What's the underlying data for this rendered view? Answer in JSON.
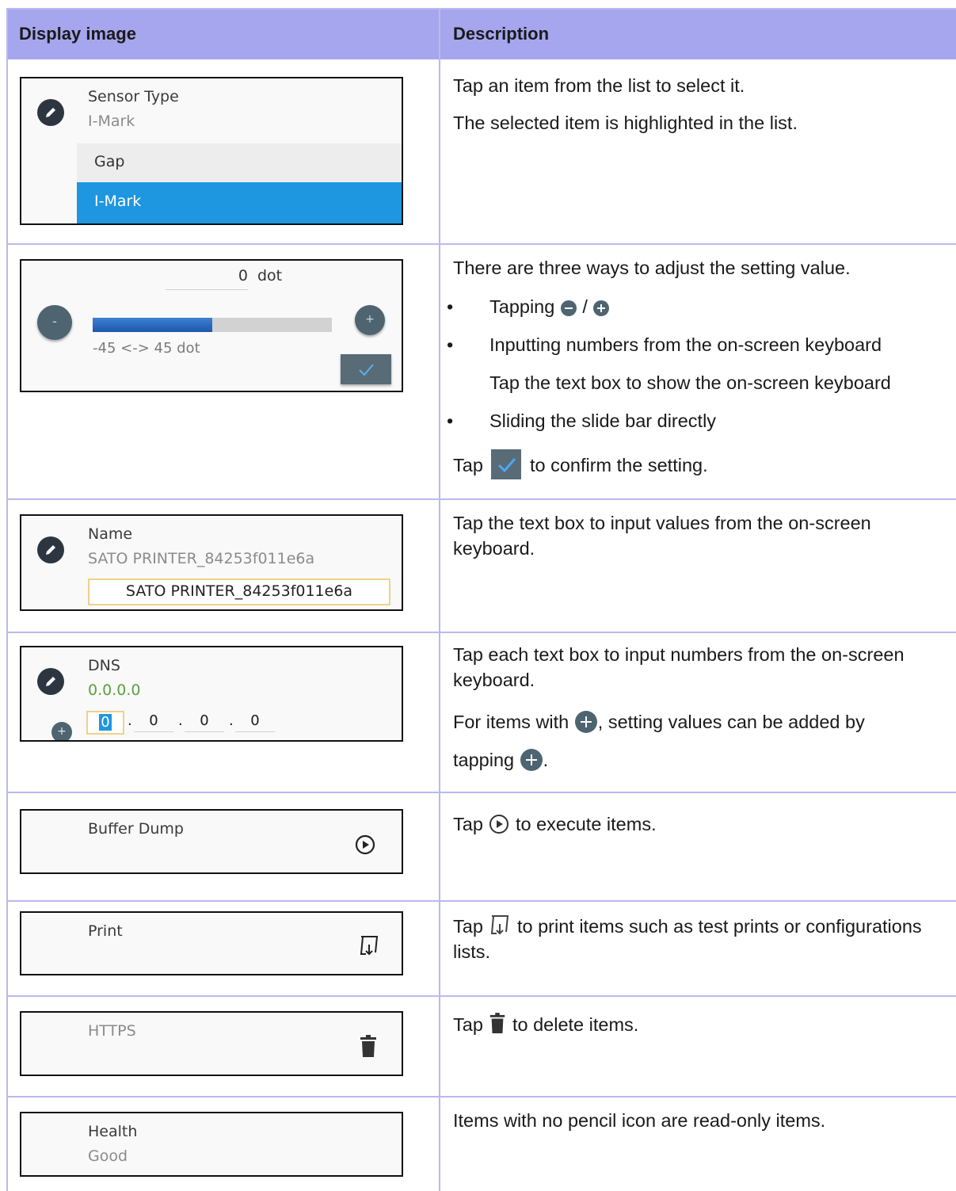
{
  "header": {
    "col1": "Display image",
    "col2": "Description"
  },
  "rows": {
    "list": {
      "title": "Sensor Type",
      "value": "I-Mark",
      "opt1": "Gap",
      "opt2": "I-Mark",
      "desc1": "Tap an item from the list to select it.",
      "desc2": "The selected item is highlighted in the list."
    },
    "slider": {
      "value": "0",
      "unit": "dot",
      "range": "-45 <-> 45 dot",
      "minus": "-",
      "plus": "+",
      "level": 0.5,
      "desc_intro": "There are three ways to adjust the setting value.",
      "bullet1": "Tapping",
      "bullet1_sep": "/",
      "bullet2": "Inputting numbers from the on-screen keyboard",
      "bullet2_sub": "Tap the text box to show the on-screen keyboard",
      "bullet3": "Sliding the slide bar directly",
      "confirm_pre": "Tap",
      "confirm_post": "to confirm the setting."
    },
    "text": {
      "title": "Name",
      "value": "SATO PRINTER_84253f011e6a",
      "input": "SATO PRINTER_84253f011e6a",
      "desc": "Tap the text box to input values from the on-screen keyboard."
    },
    "ip": {
      "title": "DNS",
      "value": "0.0.0.0",
      "oct1": "0",
      "oct2": "0",
      "oct3": "0",
      "oct4": "0",
      "desc1": "Tap each text box to input numbers from the on-screen keyboard.",
      "desc2_pre": "For items with",
      "desc2_post": ", setting values can be added by",
      "desc3_pre": "tapping",
      "desc3_post": "."
    },
    "exec": {
      "title": "Buffer Dump",
      "desc_pre": "Tap",
      "desc_post": "to execute items."
    },
    "print": {
      "title": "Print",
      "desc_pre": "Tap",
      "desc_post": "to print items such as test prints or configurations lists."
    },
    "delete": {
      "title": "HTTPS",
      "desc_pre": "Tap",
      "desc_post": "to delete items."
    },
    "readonly": {
      "title": "Health",
      "value": "Good",
      "desc": "Items with no pencil icon are read-only items."
    }
  },
  "colors": {
    "header_bg": "#a6a6ee",
    "grid": "#b9b9ef",
    "highlight": "#1e96e0",
    "ip_green": "#5aa040",
    "slider_fill": "#2f6bbf"
  },
  "icons": [
    "pencil-icon",
    "minus-icon",
    "plus-icon",
    "check-icon",
    "play-circle-icon",
    "print-icon",
    "trash-icon"
  ]
}
